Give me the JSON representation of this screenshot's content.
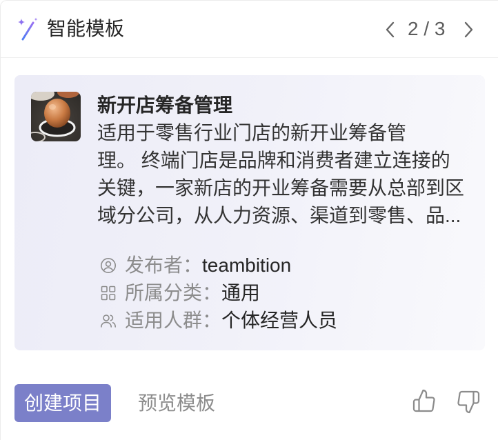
{
  "header": {
    "title": "智能模板",
    "icon": "magic-wand-icon",
    "pager_label": "2 / 3",
    "prev_icon": "chevron-left-icon",
    "next_icon": "chevron-right-icon"
  },
  "template_card": {
    "thumbnail": "egg-photo-thumbnail",
    "title": "新开店筹备管理",
    "description_lines": [
      "适用于零售行业门店的新开业筹备管",
      "理。 终端门店是品牌和消费者建立连接的",
      "关键，一家新店的开业筹备需要从总部到区",
      "域分公司，从人力资源、渠道到零售、品..."
    ],
    "meta": [
      {
        "icon": "user-circle-icon",
        "label": "发布者：",
        "value": "teambition"
      },
      {
        "icon": "grid-icon",
        "label": "所属分类：",
        "value": "通用"
      },
      {
        "icon": "users-icon",
        "label": "适用人群：",
        "value": "个体经营人员"
      }
    ]
  },
  "actions": {
    "create_label": "创建项目",
    "preview_label": "预览模板",
    "like_icon": "thumbs-up-icon",
    "dislike_icon": "thumbs-down-icon"
  },
  "colors": {
    "accent": "#7b80c9",
    "muted": "#8c8c8c",
    "text": "#262626",
    "body": "#333333"
  }
}
